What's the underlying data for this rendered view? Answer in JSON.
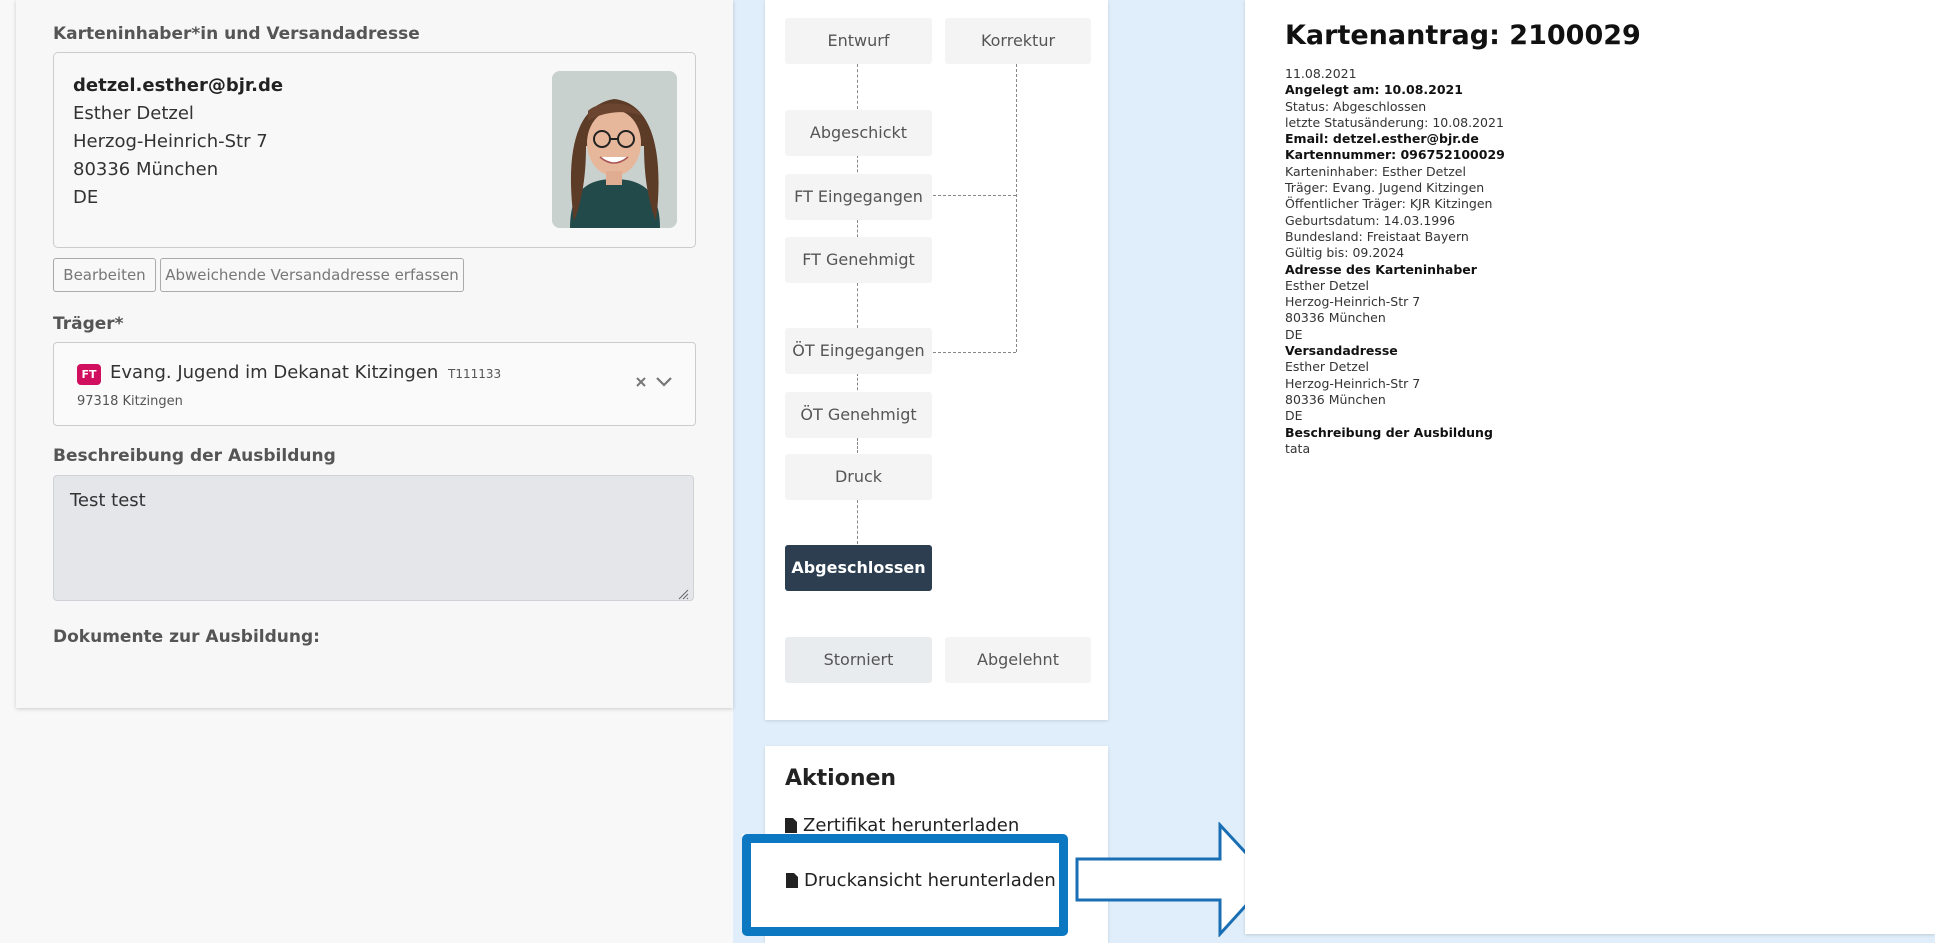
{
  "form": {
    "section_card_holder": "Karteninhaber*in und Versandadresse",
    "address": {
      "email": "detzel.esther@bjr.de",
      "name": "Esther Detzel",
      "street": "Herzog-Heinrich-Str 7",
      "city": "80336 München",
      "country": "DE"
    },
    "btn_edit": "Bearbeiten",
    "btn_other_address": "Abweichende Versandadresse erfassen",
    "section_carrier": "Träger*",
    "carrier": {
      "badge": "FT",
      "name": "Evang. Jugend im Dekanat Kitzingen",
      "code": "T111133",
      "location": "97318 Kitzingen"
    },
    "section_description": "Beschreibung der Ausbildung",
    "description_value": "Test test",
    "section_documents": "Dokumente zur Ausbildung:"
  },
  "workflow": {
    "entwurf": "Entwurf",
    "korrektur": "Korrektur",
    "abgeschickt": "Abgeschickt",
    "ft_eingegangen": "FT Eingegangen",
    "ft_genehmigt": "FT Genehmigt",
    "oet_eingegangen": "ÖT Eingegangen",
    "oet_genehmigt": "ÖT Genehmigt",
    "druck": "Druck",
    "abgeschlossen": "Abgeschlossen",
    "storniert": "Storniert",
    "abgelehnt": "Abgelehnt"
  },
  "actions": {
    "title": "Aktionen",
    "download_certificate": "Zertifikat herunterladen",
    "download_print": "Druckansicht herunterladen"
  },
  "preview": {
    "title": "Kartenantrag: 2100029",
    "lines": [
      {
        "text": "11.08.2021",
        "bold": false
      },
      {
        "text": "Angelegt am: 10.08.2021",
        "bold": true
      },
      {
        "text": "Status: Abgeschlossen",
        "bold": false
      },
      {
        "text": "letzte Statusänderung: 10.08.2021",
        "bold": false
      },
      {
        "text": "Email: detzel.esther@bjr.de",
        "bold": true
      },
      {
        "text": "Kartennummer: 096752100029",
        "bold": true
      },
      {
        "text": "Karteninhaber: Esther Detzel",
        "bold": false
      },
      {
        "text": "Träger: Evang. Jugend Kitzingen",
        "bold": false
      },
      {
        "text": "Öffentlicher Träger: KJR Kitzingen",
        "bold": false
      },
      {
        "text": "Geburtsdatum: 14.03.1996",
        "bold": false
      },
      {
        "text": "Bundesland: Freistaat Bayern",
        "bold": false
      },
      {
        "text": "Gültig bis: 09.2024",
        "bold": false
      },
      {
        "text": "Adresse des Karteninhaber",
        "bold": true
      },
      {
        "text": "Esther Detzel",
        "bold": false
      },
      {
        "text": "Herzog-Heinrich-Str 7",
        "bold": false
      },
      {
        "text": "80336 München",
        "bold": false
      },
      {
        "text": "DE",
        "bold": false
      },
      {
        "text": "Versandadresse",
        "bold": true
      },
      {
        "text": "Esther Detzel",
        "bold": false
      },
      {
        "text": "Herzog-Heinrich-Str 7",
        "bold": false
      },
      {
        "text": "80336 München",
        "bold": false
      },
      {
        "text": "DE",
        "bold": false
      },
      {
        "text": "Beschreibung der Ausbildung",
        "bold": true
      },
      {
        "text": "tata",
        "bold": false
      }
    ]
  }
}
